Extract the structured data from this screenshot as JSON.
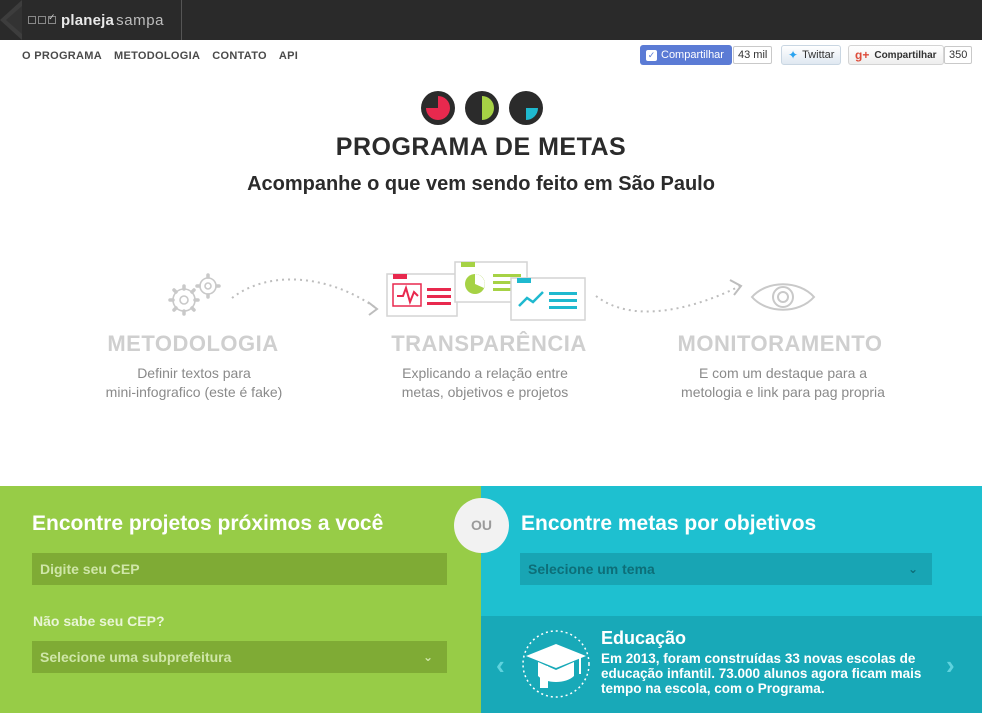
{
  "topbar": {
    "logo_bold": "planeja",
    "logo_light": "sampa"
  },
  "nav": [
    "O PROGRAMA",
    "METODOLOGIA",
    "CONTATO",
    "API"
  ],
  "share": {
    "facebook_label": "Compartilhar",
    "facebook_count": "43 mil",
    "twitter_label": "Twittar",
    "gplus_label": "Compartilhar",
    "gplus_count": "350"
  },
  "hero": {
    "title": "PROGRAMA DE METAS",
    "subtitle": "Acompanhe o que vem sendo feito em São Paulo"
  },
  "features": [
    {
      "title": "METODOLOGIA",
      "desc1": "Definir textos para",
      "desc2": "mini-infografico (este é fake)",
      "icon": "gears-icon"
    },
    {
      "title": "TRANSPARÊNCIA",
      "desc1": "Explicando a relação entre",
      "desc2": "metas, objetivos e projetos",
      "icon": "dashboards-icon"
    },
    {
      "title": "MONITORAMENTO",
      "desc1": "E com um destaque para a",
      "desc2": "metologia e link para pag propria",
      "icon": "eye-icon"
    }
  ],
  "left_panel": {
    "title": "Encontre projetos próximos a você",
    "cep_placeholder": "Digite seu CEP",
    "hint": "Não sabe seu CEP?",
    "subprefeitura_label": "Selecione uma subprefeitura"
  },
  "or_label": "OU",
  "right_panel": {
    "title": "Encontre metas por objetivos",
    "theme_label": "Selecione um tema"
  },
  "highlight": {
    "title": "Educação",
    "desc": "Em 2013, foram construídas 33 novas escolas de educação infantil. 73.000 alunos agora ficam mais tempo na escola, com o Programa.",
    "icon": "graduation-cap-icon"
  },
  "colors": {
    "topbar": "#2a2a2a",
    "green": "#97cc47",
    "cyan": "#1ec0d0",
    "teal": "#18a9b8",
    "red": "#e8294e",
    "lime": "#a6d245",
    "blue": "#1fb9cf"
  }
}
